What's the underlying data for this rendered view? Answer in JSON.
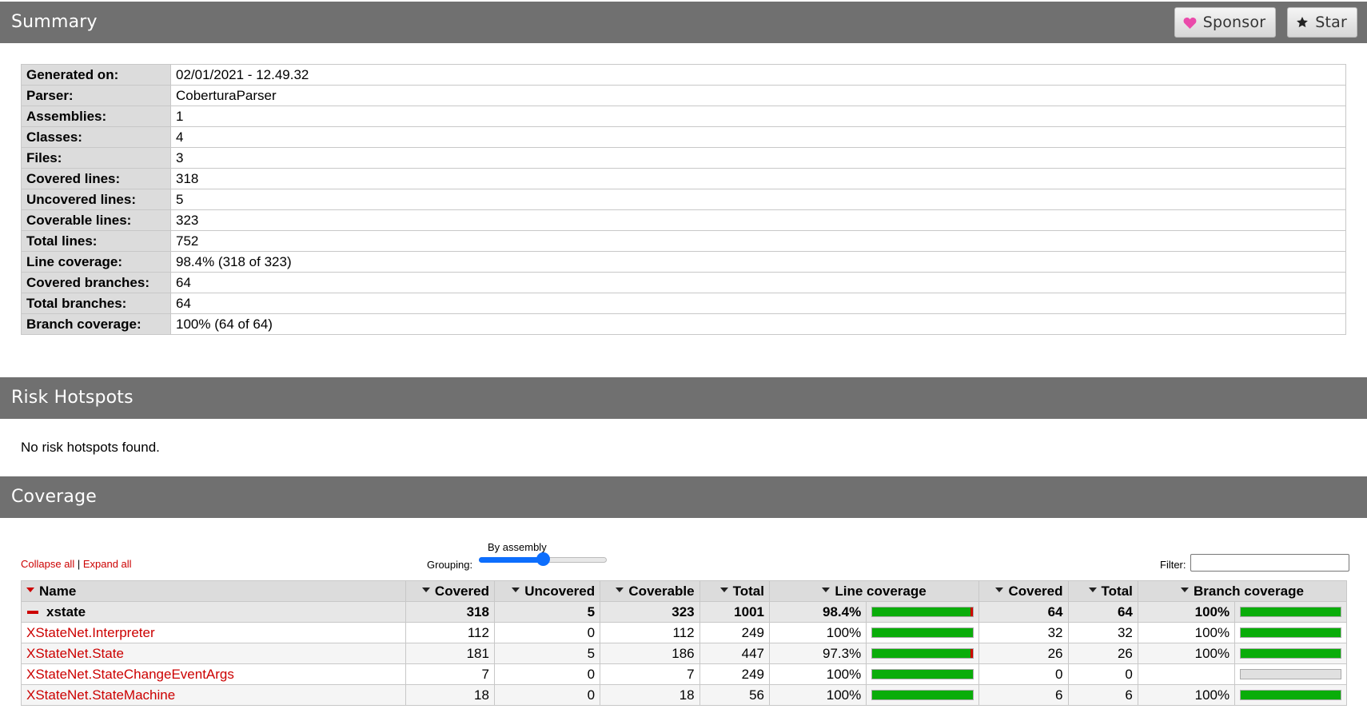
{
  "summary": {
    "title": "Summary",
    "sponsor_label": "Sponsor",
    "star_label": "Star",
    "rows": [
      {
        "label": "Generated on:",
        "value": "02/01/2021 - 12.49.32"
      },
      {
        "label": "Parser:",
        "value": "CoberturaParser"
      },
      {
        "label": "Assemblies:",
        "value": "1"
      },
      {
        "label": "Classes:",
        "value": "4"
      },
      {
        "label": "Files:",
        "value": "3"
      },
      {
        "label": "Covered lines:",
        "value": "318"
      },
      {
        "label": "Uncovered lines:",
        "value": "5"
      },
      {
        "label": "Coverable lines:",
        "value": "323"
      },
      {
        "label": "Total lines:",
        "value": "752"
      },
      {
        "label": "Line coverage:",
        "value": "98.4% (318 of 323)"
      },
      {
        "label": "Covered branches:",
        "value": "64"
      },
      {
        "label": "Total branches:",
        "value": "64"
      },
      {
        "label": "Branch coverage:",
        "value": "100% (64 of 64)"
      }
    ]
  },
  "risk": {
    "title": "Risk Hotspots",
    "message": "No risk hotspots found."
  },
  "coverage": {
    "title": "Coverage",
    "collapse_all": "Collapse all",
    "separator": "|",
    "expand_all": "Expand all",
    "grouping_label": "Grouping:",
    "grouping_value": "By assembly",
    "grouping_level": 0.5,
    "filter_label": "Filter:",
    "filter_value": "",
    "columns": {
      "name": "Name",
      "covered": "Covered",
      "uncovered": "Uncovered",
      "coverable": "Coverable",
      "total": "Total",
      "line_coverage": "Line coverage",
      "branch_covered": "Covered",
      "branch_total": "Total",
      "branch_coverage": "Branch coverage"
    },
    "assembly": {
      "name": "xstate",
      "covered": "318",
      "uncovered": "5",
      "coverable": "323",
      "total": "1001",
      "line_pct": "98.4%",
      "line_fraction": 0.984,
      "branch_covered": "64",
      "branch_total": "64",
      "branch_pct": "100%",
      "branch_fraction": 1.0
    },
    "classes": [
      {
        "name": "XStateNet.Interpreter",
        "covered": "112",
        "uncovered": "0",
        "coverable": "112",
        "total": "249",
        "line_pct": "100%",
        "line_fraction": 1.0,
        "branch_covered": "32",
        "branch_total": "32",
        "branch_pct": "100%",
        "branch_fraction": 1.0
      },
      {
        "name": "XStateNet.State",
        "covered": "181",
        "uncovered": "5",
        "coverable": "186",
        "total": "447",
        "line_pct": "97.3%",
        "line_fraction": 0.973,
        "branch_covered": "26",
        "branch_total": "26",
        "branch_pct": "100%",
        "branch_fraction": 1.0
      },
      {
        "name": "XStateNet.StateChangeEventArgs",
        "covered": "7",
        "uncovered": "0",
        "coverable": "7",
        "total": "249",
        "line_pct": "100%",
        "line_fraction": 1.0,
        "branch_covered": "0",
        "branch_total": "0",
        "branch_pct": "",
        "branch_fraction": null
      },
      {
        "name": "XStateNet.StateMachine",
        "covered": "18",
        "uncovered": "0",
        "coverable": "18",
        "total": "56",
        "line_pct": "100%",
        "line_fraction": 1.0,
        "branch_covered": "6",
        "branch_total": "6",
        "branch_pct": "100%",
        "branch_fraction": 1.0
      }
    ]
  },
  "colors": {
    "header_bg": "#707070",
    "link_red": "#cc0000",
    "bar_green": "#0aad0a",
    "bar_red": "#cc0000",
    "slider_blue": "#0d6efd"
  },
  "icons": {
    "sponsor": "heart-icon",
    "star": "star-icon",
    "sort": "sort-desc-icon",
    "collapse": "minus-icon"
  }
}
